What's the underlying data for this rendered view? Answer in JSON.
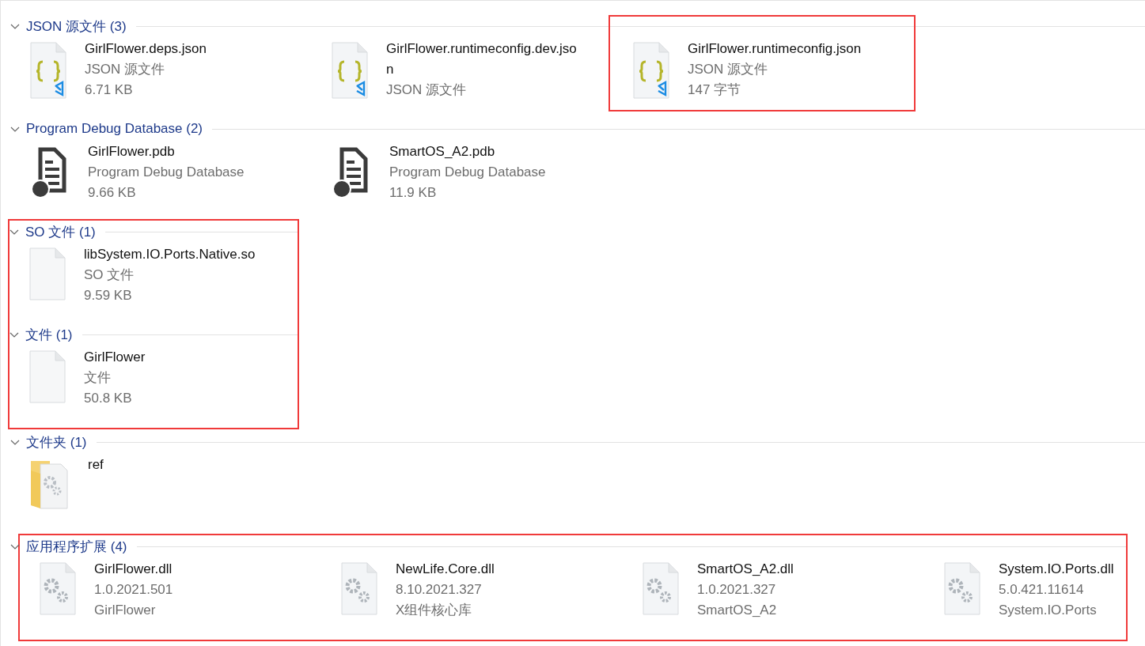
{
  "groups": [
    {
      "title": "JSON 源文件 (3)",
      "expanded": true,
      "highlighted": false,
      "items": [
        {
          "kind": "json",
          "name": "GirlFlower.deps.json",
          "line_2": "JSON 源文件",
          "line_3": "6.71 KB",
          "highlighted": false
        },
        {
          "kind": "json",
          "name": "GirlFlower.runtimeconfig.dev.json",
          "line_2": "JSON 源文件",
          "highlighted": false
        },
        {
          "kind": "json",
          "name": "GirlFlower.runtimeconfig.json",
          "line_2": "JSON 源文件",
          "line_3": "147 字节",
          "highlighted": true
        }
      ]
    },
    {
      "title": "Program Debug Database (2)",
      "expanded": true,
      "highlighted": false,
      "items": [
        {
          "kind": "pdb",
          "name": "GirlFlower.pdb",
          "line_2": "Program Debug Database",
          "line_3": "9.66 KB",
          "highlighted": false
        },
        {
          "kind": "pdb",
          "name": "SmartOS_A2.pdb",
          "line_2": "Program Debug Database",
          "line_3": "11.9 KB",
          "highlighted": false
        }
      ]
    },
    {
      "title": "SO 文件 (1)",
      "expanded": true,
      "highlighted": true,
      "items": [
        {
          "kind": "blank",
          "name": "libSystem.IO.Ports.Native.so",
          "line_2": "SO 文件",
          "line_3": "9.59 KB",
          "highlighted": false
        }
      ]
    },
    {
      "title": "文件 (1)",
      "expanded": true,
      "highlighted": true,
      "items": [
        {
          "kind": "blank",
          "name": "GirlFlower",
          "line_2": "文件",
          "line_3": "50.8 KB",
          "highlighted": false
        }
      ]
    },
    {
      "title": "文件夹 (1)",
      "expanded": true,
      "highlighted": false,
      "items": [
        {
          "kind": "folder",
          "name": "ref",
          "highlighted": false
        }
      ]
    },
    {
      "title": "应用程序扩展 (4)",
      "expanded": true,
      "highlighted": true,
      "items": [
        {
          "kind": "dll",
          "name": "GirlFlower.dll",
          "line_2": "1.0.2021.501",
          "line_3": "GirlFlower",
          "highlighted": false
        },
        {
          "kind": "dll",
          "name": "NewLife.Core.dll",
          "line_2": "8.10.2021.327",
          "line_3": "X组件核心库",
          "highlighted": false
        },
        {
          "kind": "dll",
          "name": "SmartOS_A2.dll",
          "line_2": "1.0.2021.327",
          "line_3": "SmartOS_A2",
          "highlighted": false
        },
        {
          "kind": "dll",
          "name": "System.IO.Ports.dll",
          "line_2": "5.0.421.11614",
          "line_3": "System.IO.Ports",
          "highlighted": false
        }
      ]
    }
  ]
}
